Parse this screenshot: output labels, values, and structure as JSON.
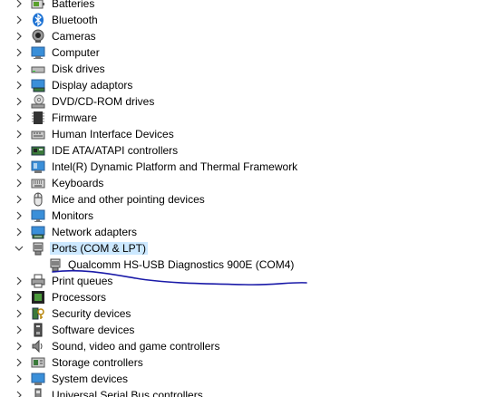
{
  "device_manager": {
    "categories": [
      {
        "label": "Batteries",
        "icon": "battery-icon",
        "expanded": false
      },
      {
        "label": "Bluetooth",
        "icon": "bluetooth-icon",
        "expanded": false
      },
      {
        "label": "Cameras",
        "icon": "camera-icon",
        "expanded": false
      },
      {
        "label": "Computer",
        "icon": "computer-icon",
        "expanded": false
      },
      {
        "label": "Disk drives",
        "icon": "disk-drive-icon",
        "expanded": false
      },
      {
        "label": "Display adaptors",
        "icon": "display-adapter-icon",
        "expanded": false
      },
      {
        "label": "DVD/CD-ROM drives",
        "icon": "dvd-drive-icon",
        "expanded": false
      },
      {
        "label": "Firmware",
        "icon": "firmware-icon",
        "expanded": false
      },
      {
        "label": "Human Interface Devices",
        "icon": "hid-icon",
        "expanded": false
      },
      {
        "label": "IDE ATA/ATAPI controllers",
        "icon": "ide-controller-icon",
        "expanded": false
      },
      {
        "label": "Intel(R) Dynamic Platform and Thermal Framework",
        "icon": "thermal-framework-icon",
        "expanded": false
      },
      {
        "label": "Keyboards",
        "icon": "keyboard-icon",
        "expanded": false
      },
      {
        "label": "Mice and other pointing devices",
        "icon": "mouse-icon",
        "expanded": false
      },
      {
        "label": "Monitors",
        "icon": "monitor-icon",
        "expanded": false
      },
      {
        "label": "Network adapters",
        "icon": "network-adapter-icon",
        "expanded": false
      },
      {
        "label": "Ports (COM & LPT)",
        "icon": "port-icon",
        "expanded": true,
        "selected": true,
        "children": [
          {
            "label": "Qualcomm HS-USB Diagnostics 900E (COM4)",
            "icon": "port-device-icon"
          }
        ]
      },
      {
        "label": "Print queues",
        "icon": "printer-icon",
        "expanded": false
      },
      {
        "label": "Processors",
        "icon": "processor-icon",
        "expanded": false
      },
      {
        "label": "Security devices",
        "icon": "security-device-icon",
        "expanded": false
      },
      {
        "label": "Software devices",
        "icon": "software-device-icon",
        "expanded": false
      },
      {
        "label": "Sound, video and game controllers",
        "icon": "sound-icon",
        "expanded": false
      },
      {
        "label": "Storage controllers",
        "icon": "storage-controller-icon",
        "expanded": false
      },
      {
        "label": "System devices",
        "icon": "system-device-icon",
        "expanded": false
      },
      {
        "label": "Universal Serial Bus controllers",
        "icon": "usb-controller-icon",
        "expanded": false
      }
    ]
  },
  "colors": {
    "selection_bg": "#cce8ff",
    "chevron": "#444444",
    "annotation_line": "#1a1aa8"
  }
}
